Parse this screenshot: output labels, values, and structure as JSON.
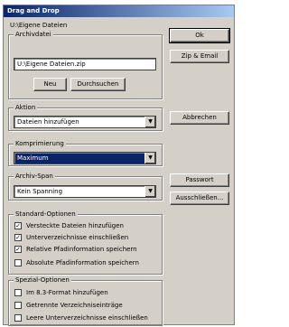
{
  "title": "Drag and Drop",
  "path_label": "U:\\Eigene Dateien",
  "archivdatei": {
    "legend": "Archivdatei",
    "value": "U:\\Eigene Dateien.zip",
    "new_label": "Neu",
    "browse_label": "Durchsuchen"
  },
  "aktion": {
    "legend": "Aktion",
    "value": "Dateien hinzufügen"
  },
  "kompression": {
    "legend": "Komprimierung",
    "value": "Maximum"
  },
  "spanning": {
    "legend": "Archiv-Span",
    "value": "Kein Spanning"
  },
  "buttons": {
    "ok": "Ok",
    "zip_email": "Zip & Email",
    "cancel": "Abbrechen",
    "password": "Passwort",
    "exclude": "Ausschließen..."
  },
  "standard": {
    "legend": "Standard-Optionen",
    "items": [
      {
        "label": "Versteckte Dateien hinzufügen",
        "checked": true
      },
      {
        "label": "Unterverzeichnisse einschließen",
        "checked": true
      },
      {
        "label": "Relative Pfadinformation speichern",
        "checked": true
      },
      {
        "label": "Absolute Pfadinformation speichern",
        "checked": false
      }
    ]
  },
  "special": {
    "legend": "Spezial-Optionen",
    "items": [
      {
        "label": "Im 8.3-Format hinzufügen",
        "checked": false
      },
      {
        "label": "Getrennte Verzeichniseinträge",
        "checked": false
      },
      {
        "label": "Leere Unterverzeichnisse einschließen",
        "checked": false
      }
    ]
  }
}
